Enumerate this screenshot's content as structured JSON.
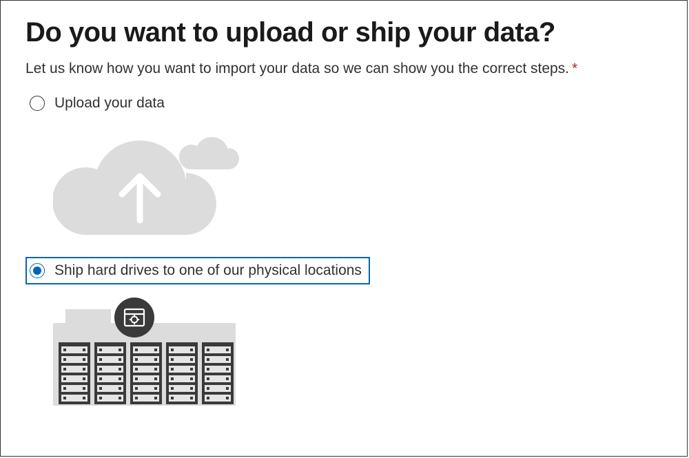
{
  "title": "Do you want to upload or ship your data?",
  "subtitle": "Let us know how you want to import your data so we can show you the correct steps.",
  "required_marker": "*",
  "options": {
    "upload": {
      "label": "Upload your data",
      "selected": false
    },
    "ship": {
      "label": "Ship hard drives to one of our physical locations",
      "selected": true
    }
  }
}
